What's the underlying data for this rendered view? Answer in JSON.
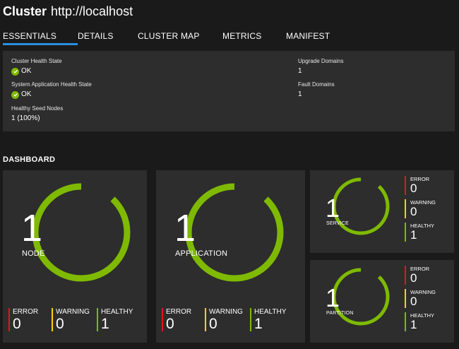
{
  "header": {
    "title": "Cluster",
    "url": "http://localhost"
  },
  "tabs": [
    {
      "label": "ESSENTIALS",
      "active": true
    },
    {
      "label": "DETAILS",
      "active": false
    },
    {
      "label": "CLUSTER MAP",
      "active": false
    },
    {
      "label": "METRICS",
      "active": false
    },
    {
      "label": "MANIFEST",
      "active": false
    }
  ],
  "essentials": {
    "cluster_health": {
      "label": "Cluster Health State",
      "value": "OK",
      "icon": "ok-check-icon"
    },
    "system_app_health": {
      "label": "System Application Health State",
      "value": "OK",
      "icon": "ok-check-icon"
    },
    "seed_nodes": {
      "label": "Healthy Seed Nodes",
      "value": "1 (100%)"
    },
    "upgrade_domains": {
      "label": "Upgrade Domains",
      "value": "1"
    },
    "fault_domains": {
      "label": "Fault Domains",
      "value": "1"
    }
  },
  "dashboard": {
    "title": "DASHBOARD",
    "status_colors": {
      "error": "#e81123",
      "warning": "#fcd116",
      "healthy": "#7fba00"
    },
    "cards": [
      {
        "count": "1",
        "label": "NODE",
        "error_label": "ERROR",
        "error": "0",
        "warning_label": "WARNING",
        "warning": "0",
        "healthy_label": "HEALTHY",
        "healthy": "1",
        "healthy_fraction": 1.0
      },
      {
        "count": "1",
        "label": "APPLICATION",
        "error_label": "ERROR",
        "error": "0",
        "warning_label": "WARNING",
        "warning": "0",
        "healthy_label": "HEALTHY",
        "healthy": "1",
        "healthy_fraction": 1.0
      },
      {
        "count": "1",
        "label": "SERVICE",
        "error_label": "ERROR",
        "error": "0",
        "warning_label": "WARNING",
        "warning": "0",
        "healthy_label": "HEALTHY",
        "healthy": "1",
        "healthy_fraction": 1.0
      },
      {
        "count": "1",
        "label": "PARTITION",
        "error_label": "ERROR",
        "error": "0",
        "warning_label": "WARNING",
        "warning": "0",
        "healthy_label": "HEALTHY",
        "healthy": "1",
        "healthy_fraction": 1.0
      }
    ]
  }
}
